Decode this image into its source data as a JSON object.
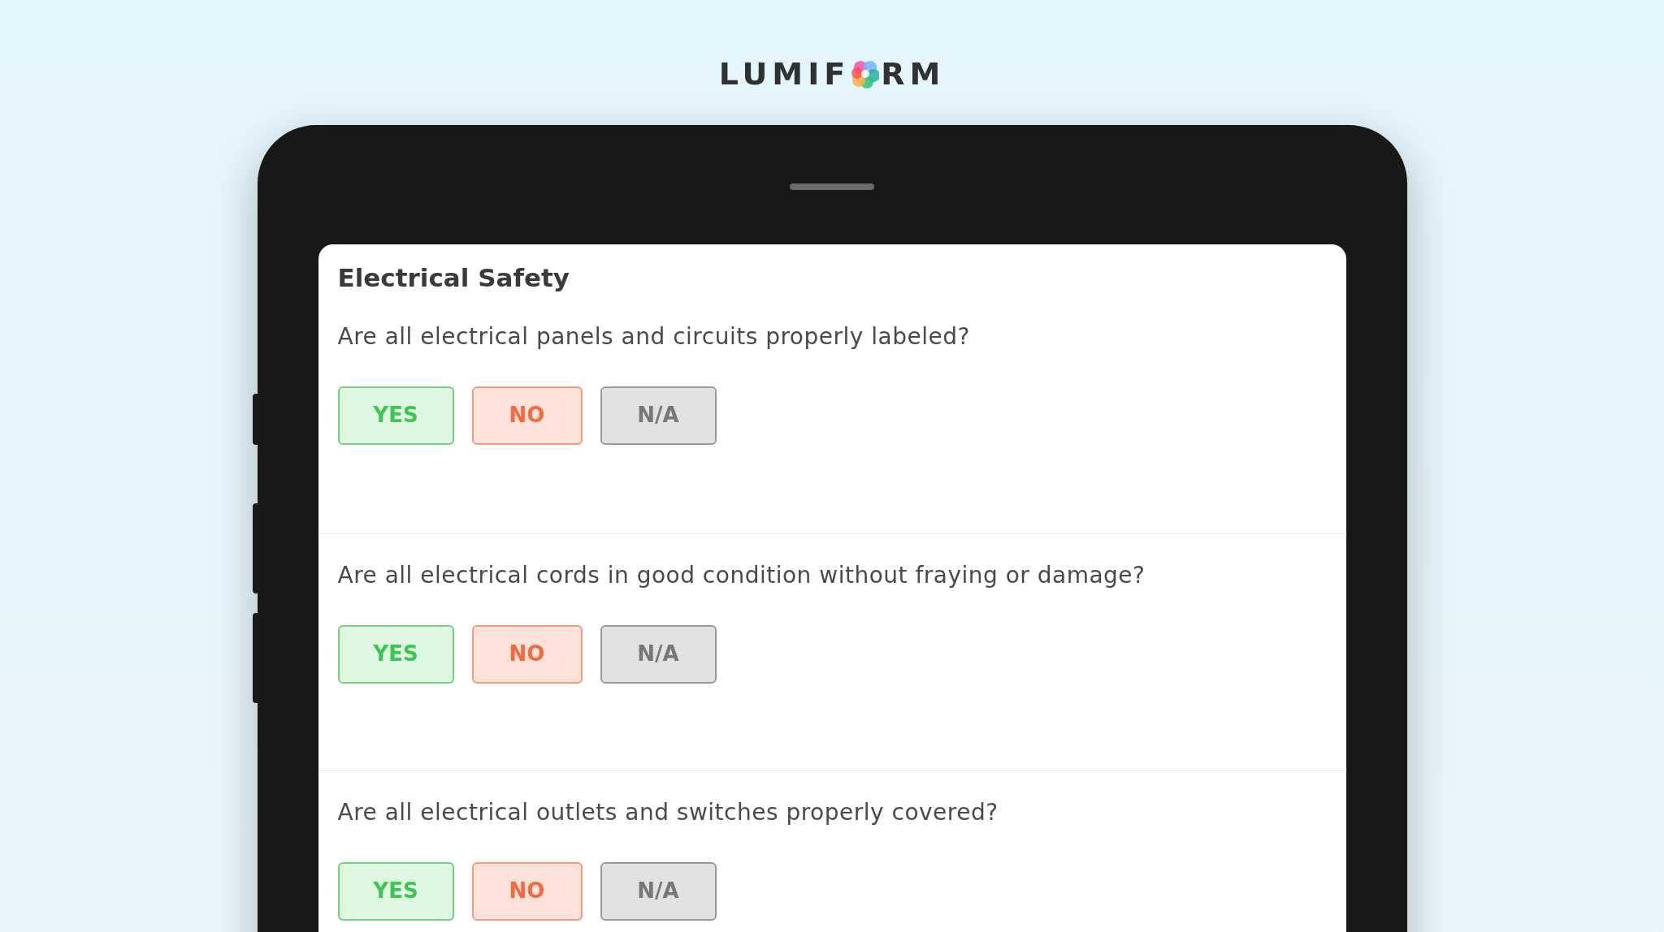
{
  "logo": {
    "before": "LUMIF",
    "after": "RM"
  },
  "form": {
    "title": "Electrical Safety",
    "questions": [
      {
        "text": "Are all electrical panels and circuits properly labeled?",
        "answers": [
          {
            "label": "YES",
            "kind": "yes"
          },
          {
            "label": "NO",
            "kind": "no"
          },
          {
            "label": "N/A",
            "kind": "na"
          }
        ]
      },
      {
        "text": "Are all electrical cords in good condition without fraying or damage?",
        "answers": [
          {
            "label": "YES",
            "kind": "yes"
          },
          {
            "label": "NO",
            "kind": "no"
          },
          {
            "label": "N/A",
            "kind": "na"
          }
        ]
      },
      {
        "text": "Are all electrical outlets and switches properly covered?",
        "answers": [
          {
            "label": "YES",
            "kind": "yes"
          },
          {
            "label": "NO",
            "kind": "no"
          },
          {
            "label": "N/A",
            "kind": "na"
          }
        ]
      }
    ]
  }
}
